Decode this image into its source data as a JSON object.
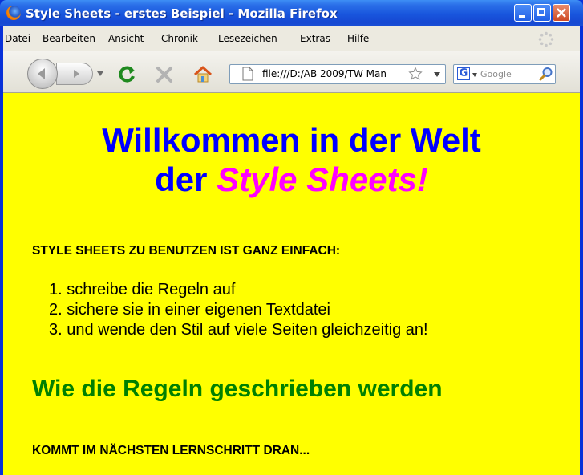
{
  "window": {
    "title": "Style Sheets - erstes Beispiel - Mozilla Firefox"
  },
  "menu": {
    "items": [
      {
        "pre": "",
        "key": "D",
        "post": "atei"
      },
      {
        "pre": "",
        "key": "B",
        "post": "earbeiten"
      },
      {
        "pre": "",
        "key": "A",
        "post": "nsicht"
      },
      {
        "pre": "",
        "key": "C",
        "post": "hronik"
      },
      {
        "pre": "",
        "key": "L",
        "post": "esezeichen"
      },
      {
        "pre": "E",
        "key": "x",
        "post": "tras"
      },
      {
        "pre": "",
        "key": "H",
        "post": "ilfe"
      }
    ]
  },
  "toolbar": {
    "url": "file:///D:/AB 2009/TW Man",
    "search_placeholder": "Google",
    "search_engine_icon": "G"
  },
  "icons": {
    "back": "back-arrow-icon",
    "forward": "forward-arrow-icon",
    "reload": "reload-icon",
    "stop": "stop-icon",
    "home": "home-icon",
    "bookmark": "star-icon",
    "search": "magnifier-icon"
  },
  "colors": {
    "page_background": "#ffff00",
    "heading_blue": "#0000ff",
    "heading_magenta": "#ff00ff",
    "heading_green": "#008000",
    "reload_green": "#1f8a1f"
  },
  "page": {
    "heading_line1": "Willkommen in der Welt",
    "heading_line2_prefix": "der ",
    "heading_line2_emph": "Style Sheets!",
    "intro": "STYLE SHEETS ZU BENUTZEN IST GANZ EINFACH:",
    "steps": [
      {
        "num": "1.",
        "text": "schreibe die Regeln auf"
      },
      {
        "num": "2.",
        "text": "sichere sie in einer eigenen Textdatei"
      },
      {
        "num": "3.",
        "text": "und wende den Stil auf viele Seiten gleichzeitig an!"
      }
    ],
    "subheading": "Wie die Regeln geschrieben werden",
    "outro": "KOMMT IM NÄCHSTEN LERNSCHRITT DRAN..."
  }
}
